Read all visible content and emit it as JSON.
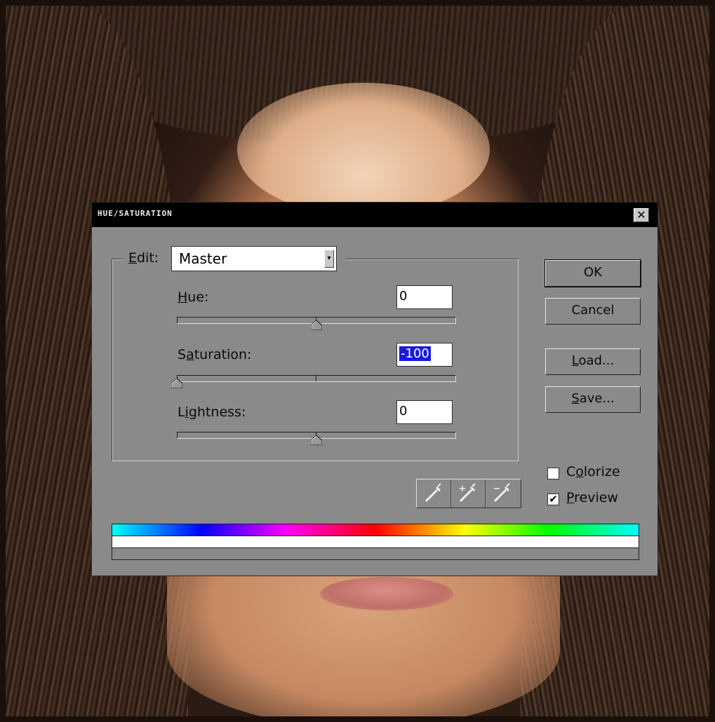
{
  "dialog": {
    "title": "HUE/SATURATION",
    "close_symbol": "✕"
  },
  "edit": {
    "label": "Edit:",
    "label_mnemonic": "E",
    "label_rest": "dit:",
    "channel": "Master",
    "channel_options_visible": [
      "Master"
    ]
  },
  "hue": {
    "label_mnemonic": "H",
    "label_rest": "ue:",
    "value": "0",
    "range": [
      -180,
      180
    ]
  },
  "saturation": {
    "label_start": "S",
    "label_mnemonic": "a",
    "label_rest": "turation:",
    "value": "-100",
    "range": [
      -100,
      100
    ]
  },
  "lightness": {
    "label_start": "L",
    "label_mnemonic": "i",
    "label_rest": "ghtness:",
    "value": "0",
    "range": [
      -100,
      100
    ]
  },
  "buttons": {
    "ok": "OK",
    "cancel": "Cancel",
    "load_mnemonic": "L",
    "load_rest": "oad...",
    "save_mnemonic": "S",
    "save_rest": "ave..."
  },
  "colorize": {
    "label_start": "C",
    "label_mnemonic": "o",
    "label_rest": "lorize",
    "checked": false
  },
  "preview": {
    "label_mnemonic": "P",
    "label_rest": "review",
    "checked": true,
    "check_mark": "✔"
  },
  "eyedroppers": [
    "eyedropper-icon",
    "eyedropper-plus-icon",
    "eyedropper-minus-icon"
  ],
  "colors": {
    "dialog_bg": "#8a8a8a",
    "titlebar_bg": "#000000",
    "selection": "#1a1ae0"
  }
}
